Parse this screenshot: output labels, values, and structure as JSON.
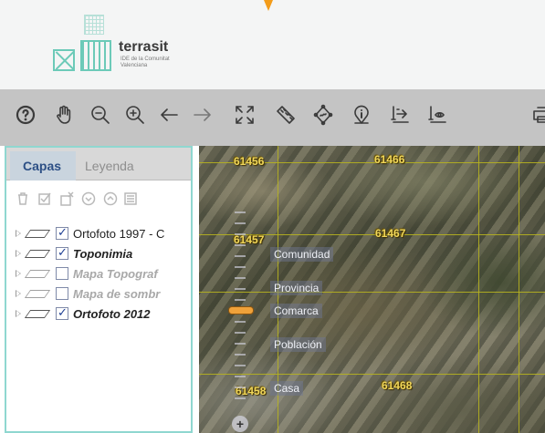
{
  "header": {
    "logo_title": "terrasit",
    "logo_subtitle": "IDE de la Comunitat Valenciana"
  },
  "toolbar": {
    "tools": [
      {
        "name": "help-icon"
      },
      {
        "name": "pan-hand-icon"
      },
      {
        "name": "zoom-out-icon"
      },
      {
        "name": "zoom-in-icon"
      },
      {
        "name": "arrow-left-icon"
      },
      {
        "name": "arrow-right-icon"
      },
      {
        "name": "full-extent-icon"
      },
      {
        "name": "ruler-icon"
      },
      {
        "name": "area-measure-icon"
      },
      {
        "name": "info-pin-icon"
      },
      {
        "name": "export-icon"
      },
      {
        "name": "view-icon"
      }
    ]
  },
  "sidebar": {
    "tabs": {
      "active": "Capas",
      "inactive": "Leyenda"
    },
    "layer_tools": [
      "trash-icon",
      "checkbox-icon",
      "remove-layer-icon",
      "move-down-icon",
      "move-up-icon",
      "properties-icon"
    ],
    "layers": [
      {
        "label": "Ortofoto 1997 - C",
        "checked": true,
        "style": "normal"
      },
      {
        "label": "Toponimia",
        "checked": true,
        "style": "bold"
      },
      {
        "label": "Mapa Topograf",
        "checked": false,
        "style": "muted"
      },
      {
        "label": "Mapa de sombr",
        "checked": false,
        "style": "muted"
      },
      {
        "label": "Ortofoto 2012",
        "checked": true,
        "style": "bold"
      }
    ]
  },
  "map": {
    "sheet_labels": [
      "61456",
      "61466",
      "61457",
      "61467",
      "61458",
      "61468"
    ],
    "zoom_scale_labels": [
      "Comunidad",
      "Provincia",
      "Comarca",
      "Población",
      "Casa"
    ],
    "zoom_plus": "+",
    "colors": {
      "grid": "#b7b31f",
      "label": "#f1d75a",
      "accent": "#f39c1a",
      "sidebar_border": "#8fd7d0"
    }
  }
}
